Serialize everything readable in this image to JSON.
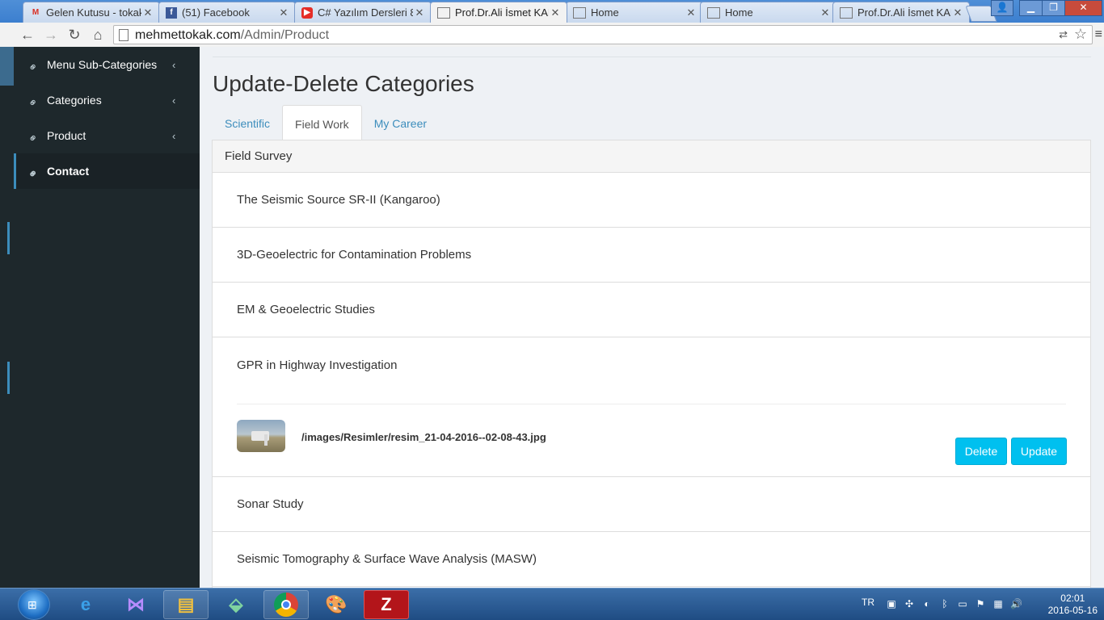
{
  "browser": {
    "tabs": [
      {
        "title": "Gelen Kutusu - tokak",
        "icon": "gmail-icon",
        "active": false
      },
      {
        "title": "(51) Facebook",
        "icon": "facebook-icon",
        "active": false
      },
      {
        "title": "C# Yazılım Dersleri 8",
        "icon": "youtube-icon",
        "active": false
      },
      {
        "title": "Prof.Dr.Ali İsmet KAN",
        "icon": "page-icon",
        "active": true
      },
      {
        "title": "Home",
        "icon": "page-icon",
        "active": false
      },
      {
        "title": "Home",
        "icon": "page-icon",
        "active": false
      },
      {
        "title": "Prof.Dr.Ali İsmet KAN",
        "icon": "page-icon",
        "active": false
      }
    ],
    "url_host": "mehmettokak.com",
    "url_path": "/Admin/Product"
  },
  "sidebar": {
    "items": [
      {
        "label": "Menu Sub-Categories",
        "has_chevron": true
      },
      {
        "label": "Categories",
        "has_chevron": true
      },
      {
        "label": "Product",
        "has_chevron": true
      },
      {
        "label": "Contact",
        "has_chevron": false,
        "active": true
      }
    ]
  },
  "main": {
    "title": "Update-Delete Categories",
    "tabs": [
      {
        "label": "Scientific"
      },
      {
        "label": "Field Work",
        "active": true
      },
      {
        "label": "My Career"
      }
    ],
    "panel_heading": "Field Survey",
    "items": [
      {
        "title": "The Seismic Source SR-II (Kangaroo)"
      },
      {
        "title": "3D-Geoelectric for Contamination Problems"
      },
      {
        "title": "EM & Geoelectric Studies"
      },
      {
        "title": "GPR in Highway Investigation",
        "expanded": true
      },
      {
        "title": "Sonar Study"
      },
      {
        "title": "Seismic Tomography & Surface Wave Analysis (MASW)"
      }
    ],
    "expanded_detail": {
      "image_path": "/images/Resimler/resim_21-04-2016--02-08-43.jpg",
      "delete_label": "Delete",
      "update_label": "Update"
    }
  },
  "taskbar": {
    "language": "TR",
    "time": "02:01",
    "date": "2016-05-16"
  }
}
